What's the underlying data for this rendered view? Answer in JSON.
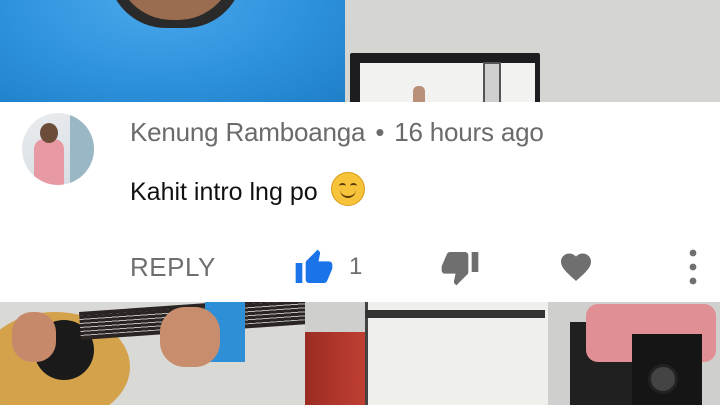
{
  "comment": {
    "author": "Kenung Ramboanga",
    "separator": "•",
    "timestamp": "16 hours ago",
    "text": "Kahit intro lng po",
    "emoji": "smiling-face-emoji"
  },
  "actions": {
    "reply_label": "REPLY",
    "like_count": "1",
    "like_icon": "thumbs-up-icon",
    "dislike_icon": "thumbs-down-icon",
    "heart_icon": "heart-icon",
    "more_icon": "more-vert-icon"
  },
  "colors": {
    "like_active": "#1a73e8",
    "icon_gray": "#6f6f6f",
    "meta_gray": "#6b6b6b",
    "card_bg": "#ffffff"
  }
}
